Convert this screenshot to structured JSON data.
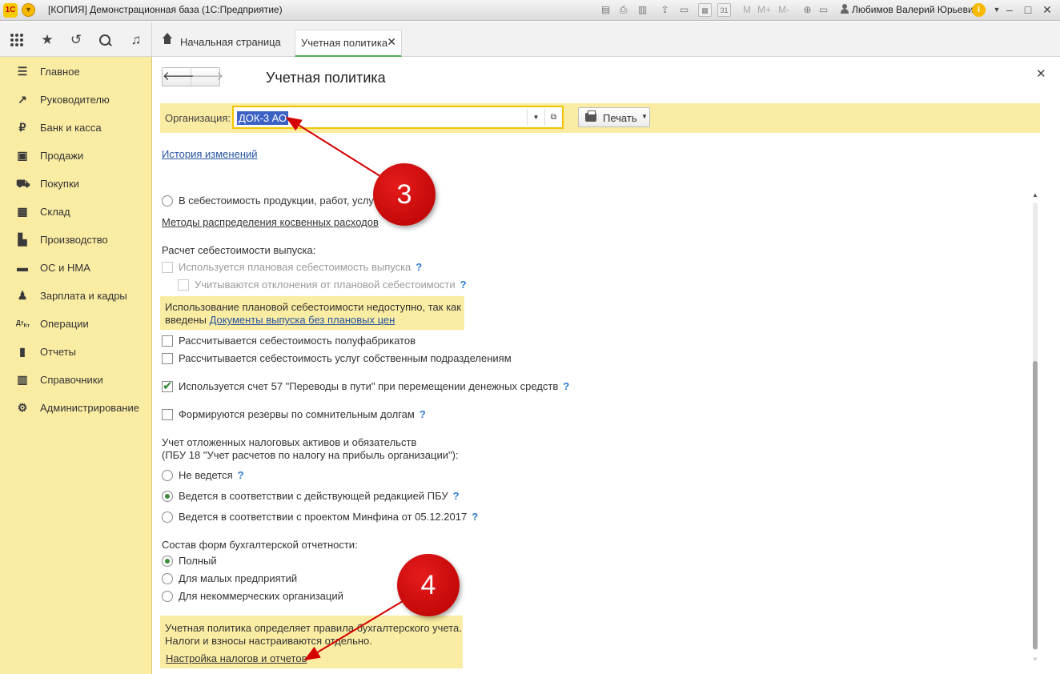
{
  "window": {
    "title": "[КОПИЯ] Демонстрационная база  (1С:Предприятие)",
    "logo_text": "1С",
    "toolbar_m_labels": [
      "M",
      "M+",
      "M-"
    ],
    "user": "Любимов Валерий Юрьевич"
  },
  "tabs": [
    {
      "label": "Начальная страница"
    },
    {
      "label": "Учетная политика"
    }
  ],
  "sidebar": {
    "items": [
      {
        "label": "Главное",
        "icon": "menu-lines-icon"
      },
      {
        "label": "Руководителю",
        "icon": "trend-icon"
      },
      {
        "label": "Банк и касса",
        "icon": "coin-icon"
      },
      {
        "label": "Продажи",
        "icon": "bag-icon"
      },
      {
        "label": "Покупки",
        "icon": "cart-icon"
      },
      {
        "label": "Склад",
        "icon": "warehouse-icon"
      },
      {
        "label": "Производство",
        "icon": "factory-icon"
      },
      {
        "label": "ОС и НМА",
        "icon": "car-icon"
      },
      {
        "label": "Зарплата и кадры",
        "icon": "person-icon"
      },
      {
        "label": "Операции",
        "icon": "dt-kt-icon"
      },
      {
        "label": "Отчеты",
        "icon": "bar-chart-icon"
      },
      {
        "label": "Справочники",
        "icon": "books-icon"
      },
      {
        "label": "Администрирование",
        "icon": "gear-icon"
      }
    ]
  },
  "form": {
    "title": "Учетная политика",
    "org_label": "Организация:",
    "org_value": "ДОК-3 АО",
    "print_label": "Печать",
    "history_link": "История изменений",
    "cost_radio_label": "В  себестоимость продукции, работ, услуг",
    "methods_link": "Методы распределения косвенных расходов",
    "cost_calc_header": "Расчет себестоимости выпуска:",
    "planned_cost_label": "Используется плановая себестоимость выпуска",
    "deviations_label": "Учитываются отклонения от плановой себестоимости",
    "planned_note_text": "Использование плановой себестоимости недоступно, так как",
    "planned_note_prefix": "введены",
    "planned_note_link": "Документы выпуска без плановых цен",
    "semi_products_label": "Рассчитывается себестоимость полуфабрикатов",
    "services_label": "Рассчитывается себестоимость услуг собственным подразделениям",
    "account57_label": "Используется счет 57 \"Переводы в пути\" при перемещении денежных средств",
    "reserves_label": "Формируются резервы по сомнительным долгам",
    "deferred_header_1": "Учет отложенных налоговых активов и обязательств",
    "deferred_header_2": "(ПБУ 18 \"Учет расчетов по налогу на прибыль организации\"):",
    "deferred_options": [
      {
        "label": "Не ведется",
        "selected": false
      },
      {
        "label": "Ведется в соответствии с действующей редакцией ПБУ",
        "selected": true
      },
      {
        "label": "Ведется в соответствии с проектом Минфина от 05.12.2017",
        "selected": false
      }
    ],
    "reporting_header": "Состав форм бухгалтерской отчетности:",
    "reporting_options": [
      {
        "label": "Полный",
        "selected": true
      },
      {
        "label": "Для малых предприятий",
        "selected": false
      },
      {
        "label": "Для некоммерческих организаций",
        "selected": false
      }
    ],
    "bottom_note_1": "Учетная политика определяет правила бухгалтерского учета.",
    "bottom_note_2": "Налоги и взносы настраиваются отдельно.",
    "tax_link": "Настройка налогов и отчетов",
    "help_mark": "?"
  },
  "annotations": {
    "badge_3": "3",
    "badge_4": "4",
    "color": "#d40000"
  },
  "colors": {
    "sidebar_bg": "#fbeca3",
    "link": "#2654a1",
    "selection": "#3b62c4",
    "active_tab_underline": "#4caf50"
  }
}
